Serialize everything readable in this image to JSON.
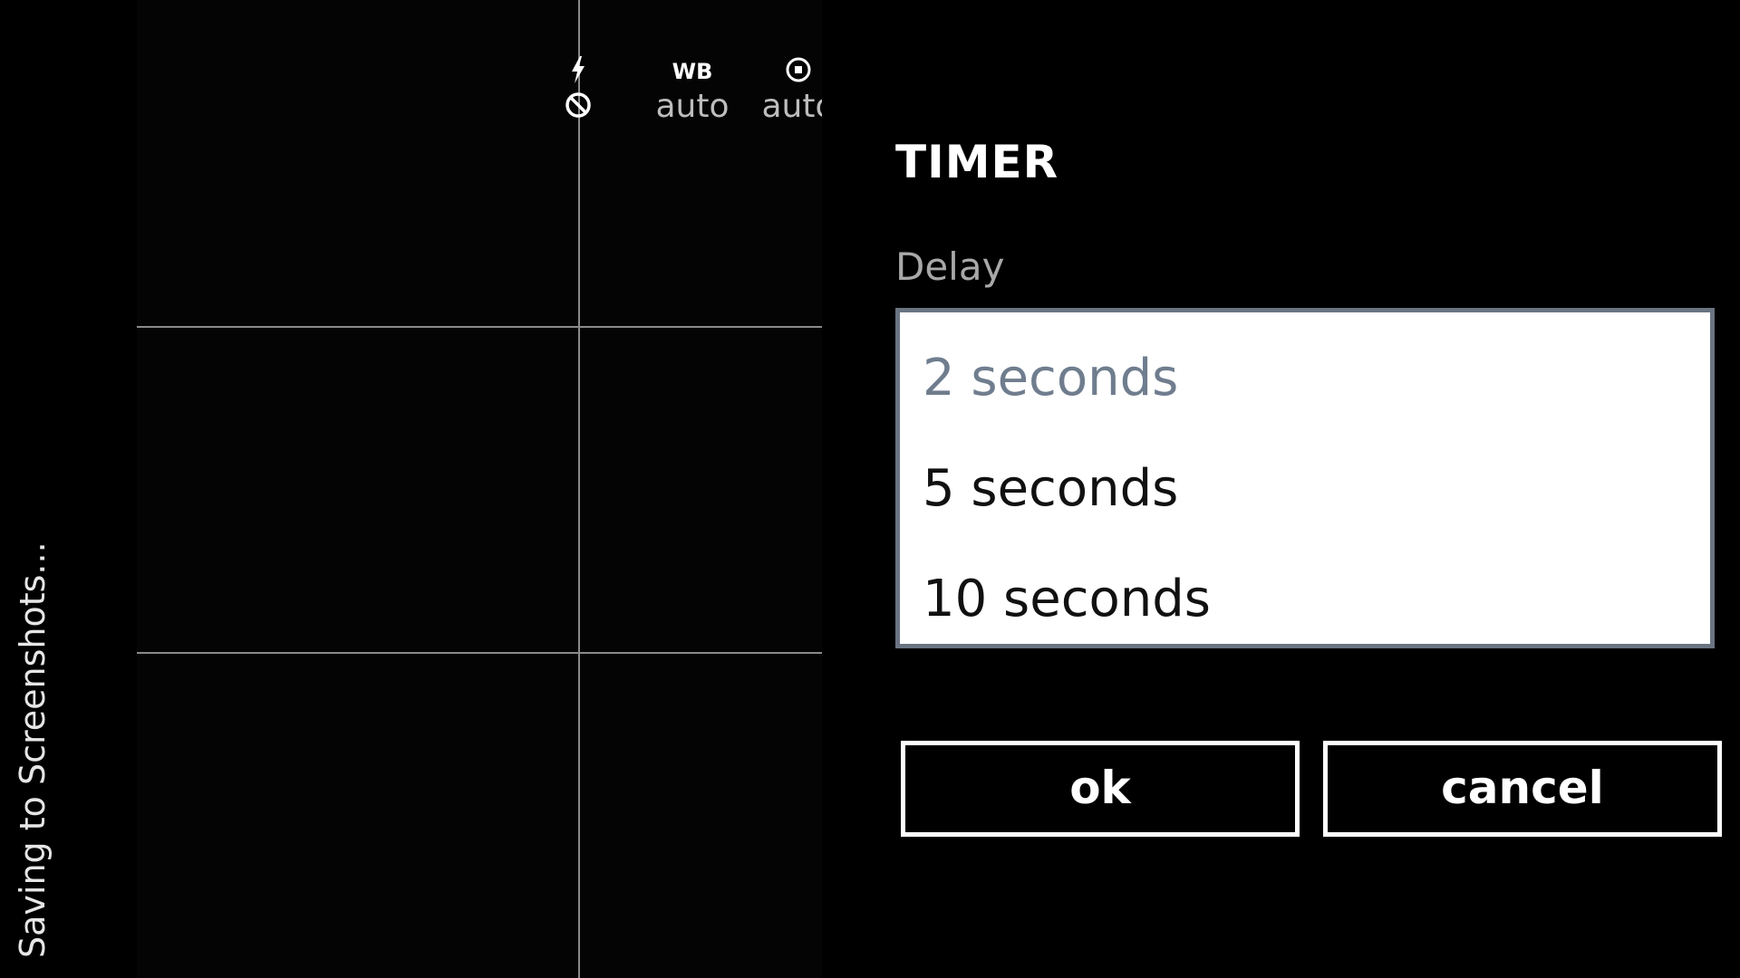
{
  "app": {
    "status_text": "Saving to Screenshots..."
  },
  "viewfinder": {
    "flash": {
      "icon_top": "flash-icon",
      "icon_bottom": "flash-off-icon"
    },
    "white_balance": {
      "label": "WB",
      "value": "auto"
    },
    "metering": {
      "icon": "metering-icon",
      "value": "auto"
    }
  },
  "timer_dialog": {
    "title": "TIMER",
    "field_label": "Delay",
    "options": [
      {
        "label": "2 seconds",
        "selected": true
      },
      {
        "label": "5 seconds",
        "selected": false
      },
      {
        "label": "10 seconds",
        "selected": false
      }
    ],
    "ok_label": "ok",
    "cancel_label": "cancel"
  },
  "colors": {
    "background": "#000000",
    "picker_border": "#6a7482",
    "selected_option": "#6f7d8e"
  }
}
